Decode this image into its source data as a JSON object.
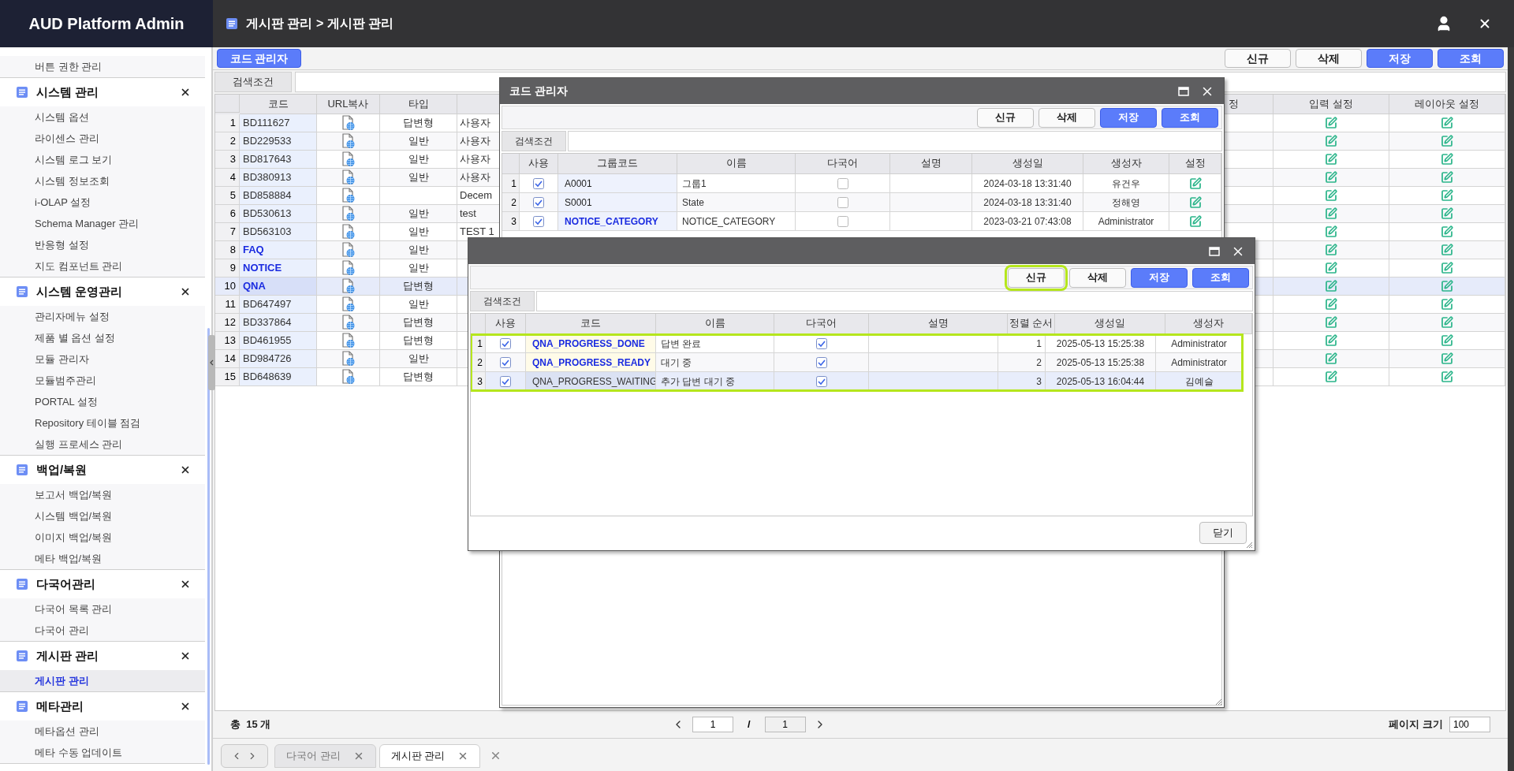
{
  "app": {
    "title": "AUD Platform Admin"
  },
  "header": {
    "breadcrumb": "게시판 관리 > 게시판 관리"
  },
  "sidebar": {
    "groups": [
      {
        "items": [
          {
            "label": "버튼 권한 관리",
            "selected": false
          }
        ]
      },
      {
        "title": "시스템 관리",
        "items": [
          {
            "label": "시스템 옵션",
            "selected": false
          },
          {
            "label": "라이센스 관리",
            "selected": false
          },
          {
            "label": "시스템 로그 보기",
            "selected": false
          },
          {
            "label": "시스템 정보조회",
            "selected": false
          },
          {
            "label": "i-OLAP 설정",
            "selected": false
          },
          {
            "label": "Schema Manager 관리",
            "selected": false
          },
          {
            "label": "반응형 설정",
            "selected": false
          },
          {
            "label": "지도 컴포넌트 관리",
            "selected": false
          }
        ]
      },
      {
        "title": "시스템 운영관리",
        "items": [
          {
            "label": "관리자메뉴 설정",
            "selected": false
          },
          {
            "label": "제품 별 옵션 설정",
            "selected": false
          },
          {
            "label": "모듈 관리자",
            "selected": false
          },
          {
            "label": "모듈범주관리",
            "selected": false
          },
          {
            "label": "PORTAL 설정",
            "selected": false
          },
          {
            "label": "Repository 테이블 점검",
            "selected": false
          },
          {
            "label": "실행 프로세스 관리",
            "selected": false
          }
        ]
      },
      {
        "title": "백업/복원",
        "items": [
          {
            "label": "보고서 백업/복원",
            "selected": false
          },
          {
            "label": "시스템 백업/복원",
            "selected": false
          },
          {
            "label": "이미지 백업/복원",
            "selected": false
          },
          {
            "label": "메타 백업/복원",
            "selected": false
          }
        ]
      },
      {
        "title": "다국어관리",
        "items": [
          {
            "label": "다국어 목록 관리",
            "selected": false
          },
          {
            "label": "다국어 관리",
            "selected": false
          }
        ]
      },
      {
        "title": "게시판 관리",
        "items": [
          {
            "label": "게시판 관리",
            "selected": true
          }
        ]
      },
      {
        "title": "메타관리",
        "items": [
          {
            "label": "메타옵션 관리",
            "selected": false
          },
          {
            "label": "메타 수동 업데이트",
            "selected": false
          }
        ]
      }
    ]
  },
  "toolbar": {
    "left_button": "코드 관리자",
    "buttons": [
      {
        "label": "신규",
        "kind": "default"
      },
      {
        "label": "삭제",
        "kind": "default"
      },
      {
        "label": "저장",
        "kind": "primary"
      },
      {
        "label": "조회",
        "kind": "primary"
      }
    ]
  },
  "search": {
    "label": "검색조건"
  },
  "table": {
    "columns": [
      "코드",
      "URL복사",
      "타입",
      "정",
      "입력 설정",
      "레이아웃 설정"
    ],
    "rows": [
      {
        "number": "1",
        "code": "BD111627",
        "emphasis": false,
        "type": "답변형",
        "column_5": "사용자",
        "selected": false
      },
      {
        "number": "2",
        "code": "BD229533",
        "emphasis": false,
        "type": "일반",
        "column_5": "사용자",
        "selected": false
      },
      {
        "number": "3",
        "code": "BD817643",
        "emphasis": false,
        "type": "일반",
        "column_5": "사용자",
        "selected": false
      },
      {
        "number": "4",
        "code": "BD380913",
        "emphasis": false,
        "type": "일반",
        "column_5": "사용자",
        "selected": false
      },
      {
        "number": "5",
        "code": "BD858884",
        "emphasis": false,
        "column_5": "Decem",
        "selected": false
      },
      {
        "number": "6",
        "code": "BD530613",
        "emphasis": false,
        "type": "일반",
        "column_5": "test",
        "selected": false
      },
      {
        "number": "7",
        "code": "BD563103",
        "emphasis": false,
        "type": "일반",
        "column_5": "TEST 1",
        "selected": false
      },
      {
        "number": "8",
        "code": "FAQ",
        "emphasis": true,
        "type": "일반",
        "selected": false
      },
      {
        "number": "9",
        "code": "NOTICE",
        "emphasis": true,
        "type": "일반",
        "selected": false
      },
      {
        "number": "10",
        "code": "QNA",
        "emphasis": true,
        "type": "답변형",
        "selected": true
      },
      {
        "number": "11",
        "code": "BD647497",
        "emphasis": false,
        "type": "일반",
        "selected": false
      },
      {
        "number": "12",
        "code": "BD337864",
        "emphasis": false,
        "type": "답변형",
        "selected": false
      },
      {
        "number": "13",
        "code": "BD461955",
        "emphasis": false,
        "type": "답변형",
        "selected": false
      },
      {
        "number": "14",
        "code": "BD984726",
        "emphasis": false,
        "type": "일반",
        "selected": false
      },
      {
        "number": "15",
        "code": "BD648639",
        "emphasis": false,
        "type": "답변형",
        "selected": false
      }
    ]
  },
  "footer": {
    "total": "총  15 개",
    "page": "1",
    "separator": "/",
    "pages": "1",
    "page_size_label": "페이지 크기",
    "page_size": "100"
  },
  "tabs": [
    {
      "label": "다국어 관리",
      "selected": false
    },
    {
      "label": "게시판 관리",
      "selected": true
    }
  ],
  "dialogs": [
    {
      "title": "코드 관리자",
      "buttons": [
        {
          "label": "신규",
          "kind": "default",
          "highlighted": false
        },
        {
          "label": "삭제",
          "kind": "default",
          "highlighted": false
        },
        {
          "label": "저장",
          "kind": "primary",
          "highlighted": false
        },
        {
          "label": "조회",
          "kind": "primary",
          "highlighted": false
        }
      ],
      "search_label": "검색조건",
      "columns": [
        {
          "label": "사용",
          "kind": "check"
        },
        {
          "label": "그룹코드",
          "kind": "code"
        },
        {
          "label": "이름",
          "kind": "text"
        },
        {
          "label": "다국어",
          "kind": "check"
        },
        {
          "label": "설명",
          "kind": "text"
        },
        {
          "label": "생성일",
          "kind": "center"
        },
        {
          "label": "생성자",
          "kind": "center"
        },
        {
          "label": "설정",
          "kind": "edit"
        }
      ],
      "rows": [
        {
          "number": "1",
          "used": true,
          "code": "A0001",
          "emphasis": false,
          "name": "그룹1",
          "multilang": false,
          "created": "2024-03-18 13:31:40",
          "creator": "유건우",
          "selected": false
        },
        {
          "number": "2",
          "used": true,
          "code": "S0001",
          "emphasis": false,
          "name": "State",
          "multilang": false,
          "created": "2024-03-18 13:31:40",
          "creator": "정해영",
          "selected": false
        },
        {
          "number": "3",
          "used": true,
          "code": "NOTICE_CATEGORY",
          "emphasis": true,
          "name": "NOTICE_CATEGORY",
          "multilang": false,
          "created": "2023-03-21 07:43:08",
          "creator": "Administrator",
          "selected": false
        }
      ]
    },
    {
      "buttons": [
        {
          "label": "신규",
          "kind": "default",
          "highlighted": true
        },
        {
          "label": "삭제",
          "kind": "default",
          "highlighted": false
        },
        {
          "label": "저장",
          "kind": "primary",
          "highlighted": false
        },
        {
          "label": "조회",
          "kind": "primary",
          "highlighted": false
        }
      ],
      "search_label": "검색조건",
      "rows_highlighted": true,
      "columns": [
        {
          "label": "사용",
          "kind": "check"
        },
        {
          "label": "코드",
          "kind": "code"
        },
        {
          "label": "이름",
          "kind": "text"
        },
        {
          "label": "다국어",
          "kind": "check"
        },
        {
          "label": "설명",
          "kind": "text"
        },
        {
          "label": "정렬 순서",
          "kind": "right"
        },
        {
          "label": "생성일",
          "kind": "center"
        },
        {
          "label": "생성자",
          "kind": "center"
        }
      ],
      "rows": [
        {
          "number": "1",
          "used": true,
          "code": "QNA_PROGRESS_DONE",
          "emphasis": true,
          "name": "답변 완료",
          "multilang": true,
          "order": "1",
          "created": "2025-05-13 15:25:38",
          "creator": "Administrator",
          "selected": false
        },
        {
          "number": "2",
          "used": true,
          "code": "QNA_PROGRESS_READY",
          "emphasis": true,
          "name": "대기 중",
          "multilang": true,
          "order": "2",
          "created": "2025-05-13 15:25:38",
          "creator": "Administrator",
          "selected": false
        },
        {
          "number": "3",
          "used": true,
          "code": "QNA_PROGRESS_WAITING",
          "emphasis": false,
          "name": "추가 답변 대기 중",
          "multilang": true,
          "order": "3",
          "created": "2025-05-13 16:04:44",
          "creator": "김예슬",
          "selected": true
        }
      ],
      "close_button": "닫기"
    }
  ]
}
